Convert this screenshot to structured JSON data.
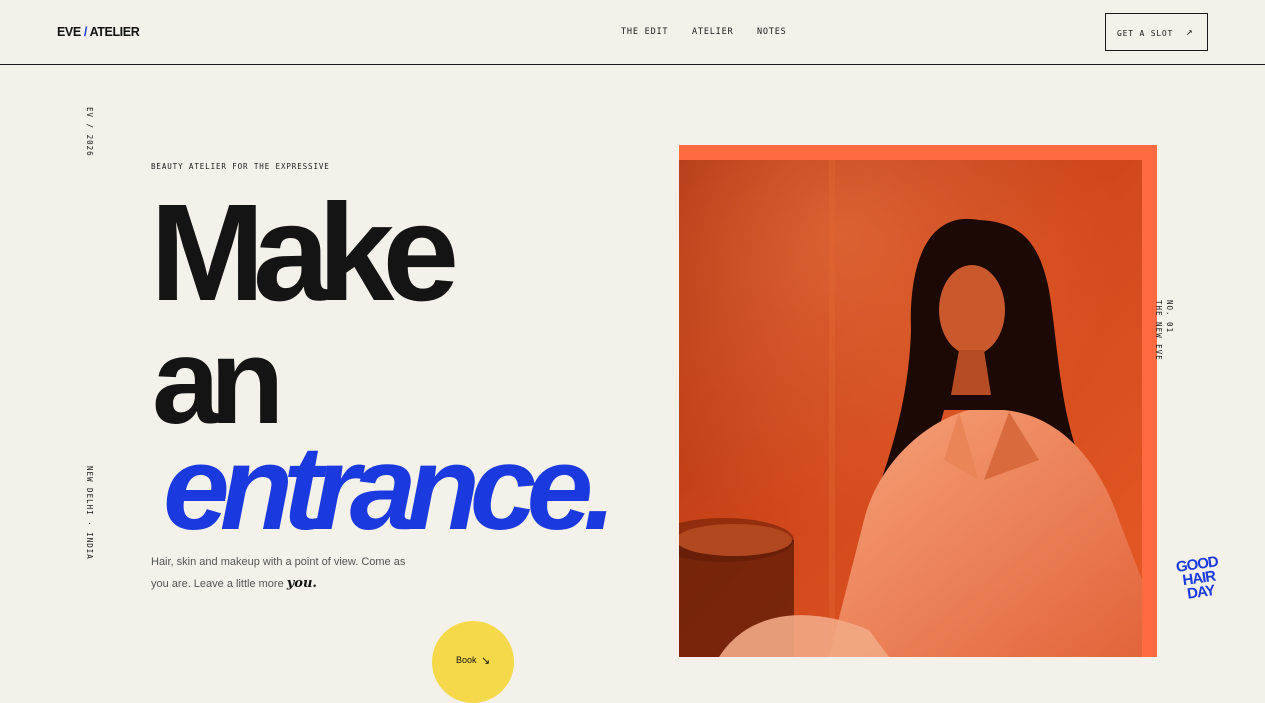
{
  "brand": {
    "eve": "EVE",
    "slash": "/",
    "atelier": "ATELIER"
  },
  "nav": {
    "items": [
      "THE EDIT",
      "ATELIER",
      "NOTES"
    ]
  },
  "cta": {
    "label": "GET A SLOT",
    "arrow_icon": "↗"
  },
  "side": {
    "top_vertical": "EV / 2026",
    "bottom_vertical": "NEW DELHI · INDIA",
    "right_vertical_1": "NO. 01",
    "right_vertical_2": "THE NEW EVE"
  },
  "hero": {
    "eyebrow": "BEAUTY ATELIER FOR THE EXPRESSIVE",
    "line1": "Make",
    "line2": "an",
    "line3": "entrance.",
    "description_part1": "Hair, skin and makeup with a point of view. Come as you are. Leave a little more ",
    "description_em": "you."
  },
  "book": {
    "label": "Book",
    "arrow_icon": "↘"
  },
  "sticker": {
    "line1": "GOOD",
    "line2": "HAIR",
    "line3": "DAY"
  },
  "colors": {
    "background": "#f4f1ea",
    "accent_blue": "#1a3ae0",
    "accent_orange": "#ff6b40",
    "accent_yellow": "#f5d94a",
    "ink": "#141414"
  }
}
